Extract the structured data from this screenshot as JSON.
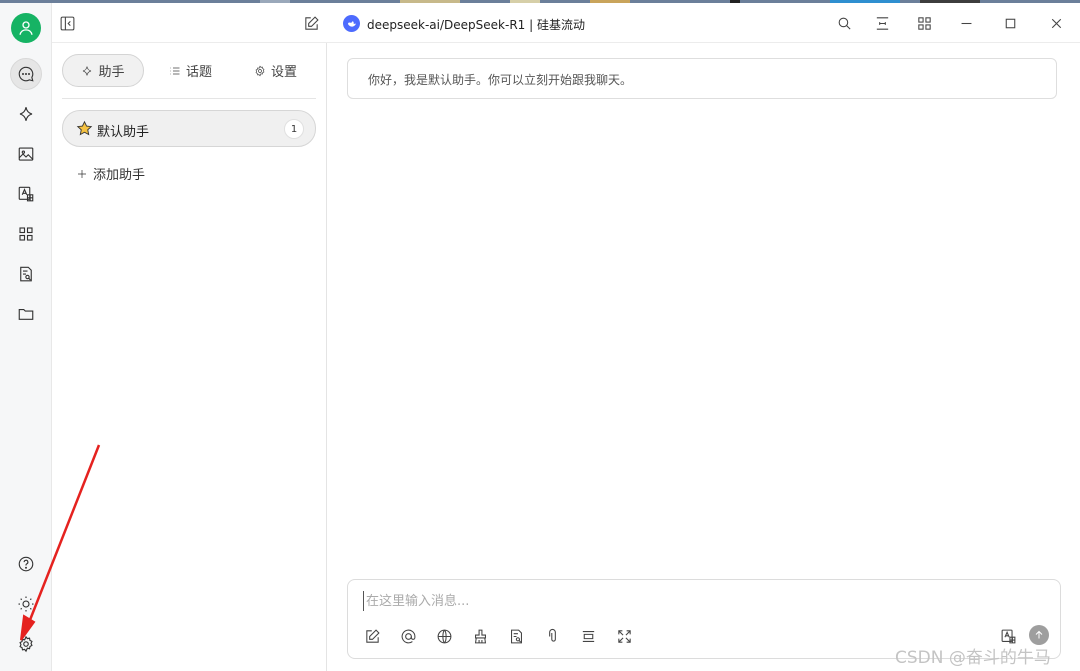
{
  "window": {
    "model_title": "deepseek-ai/DeepSeek-R1 | 硅基流动"
  },
  "rail": {
    "top_items": [
      "chat-icon",
      "sparkle-icon",
      "image-icon",
      "translate-icon",
      "apps-icon",
      "document-search-icon",
      "folder-icon"
    ],
    "bottom_items": [
      "help-icon",
      "theme-icon",
      "settings-icon"
    ]
  },
  "panel": {
    "tabs": [
      {
        "label": "助手",
        "icon": "sparkle-icon",
        "active": true
      },
      {
        "label": "话题",
        "icon": "list-icon",
        "active": false
      },
      {
        "label": "设置",
        "icon": "gear-icon",
        "active": false
      }
    ],
    "assistant": {
      "name": "默认助手",
      "count": "1",
      "icon": "star-icon"
    },
    "add_label": "添加助手"
  },
  "chat": {
    "greeting": "你好，我是默认助手。你可以立刻开始跟我聊天。",
    "composer": {
      "placeholder": "在这里输入消息..."
    }
  },
  "watermark": "CSDN @奋斗的牛马",
  "colors": {
    "avatar": "#16b364",
    "model_logo": "#4d6bfe",
    "annotation_arrow": "#e5221f"
  }
}
